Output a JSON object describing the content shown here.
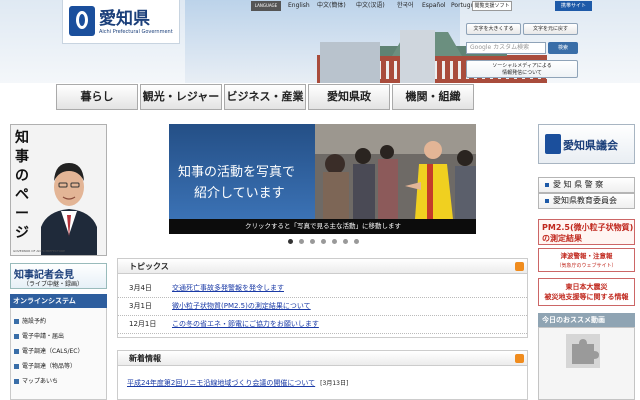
{
  "header": {
    "logo_title": "愛知県",
    "logo_subtitle": "Aichi Prefectural Government",
    "lang_label": "LANGUAGE",
    "languages": [
      "English",
      "中文(簡体)",
      "中文(汉语)",
      "한국어",
      "Español",
      "Português"
    ],
    "support_label": "閲覧支援ソフト",
    "sitemap_label": "携帯サイト",
    "font_size_label": "文字を大きくする",
    "font_color_label": "文字を元に戻す",
    "search_placeholder": "Google カスタム検索",
    "search_button": "検索",
    "social_line1": "ソーシャルメディアによる",
    "social_line2": "情報発信について"
  },
  "gnav": [
    "暮らし",
    "観光・レジャー",
    "ビジネス・産業",
    "愛知県政",
    "機関・組織"
  ],
  "governor": {
    "title": "知事のページ",
    "caption": "GOVERNOR OF AICHI PREFECTURE"
  },
  "press": {
    "line1": "知事記者会見",
    "line2": "（ライブ中継・録画）"
  },
  "online": {
    "heading": "オンラインシステム",
    "items": [
      "施設予約",
      "電子申請・届出",
      "電子調達（CALS/EC）",
      "電子調達（物品等）",
      "マップあいち"
    ]
  },
  "slideshow": {
    "line1": "知事の活動を写真で",
    "line2": "紹介しています",
    "caption": "クリックすると「写真で見る主な活動」に移動します",
    "dot_count": 7,
    "active_dot": 0
  },
  "topics": {
    "heading": "トピックス",
    "items": [
      {
        "date": "3月4日",
        "text": "交通死亡事故多発警報を発令します"
      },
      {
        "date": "3月1日",
        "text": "微小粒子状物質(PM2.5)の測定結果について"
      },
      {
        "date": "12月1日",
        "text": "この冬の省エネ・節電にご協力をお願いします"
      }
    ]
  },
  "news": {
    "heading": "新着情報",
    "items": [
      {
        "text": "平成24年度第2回リニモ沿線地域づくり会議の開催について",
        "date": "[3月13日]"
      }
    ]
  },
  "right": {
    "assembly": "愛知県議会",
    "police": "愛 知 県 警 察",
    "education": "愛知県教育委員会",
    "pm25_line1": "PM2.5(微小粒子状物質)",
    "pm25_line2": "の測定結果",
    "tsunami_line1": "津波警報・注意報",
    "tsunami_line2": "（気象庁のウェブサイト）",
    "quake_line1": "東日本大震災",
    "quake_line2": "被災地支援等に関する情報",
    "video_heading": "今日のおススメ動画"
  },
  "colors": {
    "brand": "#1b4f9c",
    "link": "#1a3aa6",
    "alert": "#c0281e",
    "rss": "#f08c1e"
  }
}
